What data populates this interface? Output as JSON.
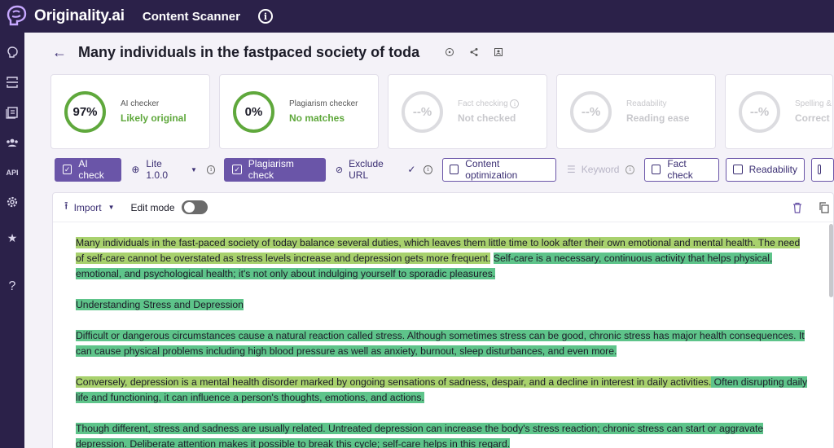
{
  "brand": {
    "name": "Originality.ai",
    "app_title": "Content Scanner"
  },
  "document": {
    "title": "Many individuals in the fastpaced society of toda"
  },
  "cards": [
    {
      "score": "97%",
      "label": "AI checker",
      "value": "Likely original",
      "active": true
    },
    {
      "score": "0%",
      "label": "Plagiarism checker",
      "value": "No matches",
      "active": true
    },
    {
      "score": "--%",
      "label": "Fact checking",
      "value": "Not checked",
      "active": false
    },
    {
      "score": "--%",
      "label": "Readability",
      "value": "Reading ease",
      "active": false
    },
    {
      "score": "--%",
      "label": "Spelling &",
      "value": "Correct",
      "active": false
    }
  ],
  "toolbar": {
    "ai_check": "AI check",
    "model": "Lite 1.0.0",
    "plagiarism_check": "Plagiarism check",
    "exclude_url": "Exclude URL",
    "content_optimization": "Content optimization",
    "keyword": "Keyword",
    "fact_check": "Fact check",
    "readability": "Readability"
  },
  "editor": {
    "import_label": "Import",
    "edit_mode_label": "Edit mode",
    "edit_mode_on": false,
    "paragraphs": [
      [
        {
          "text": "Many individuals in the fast-paced society of today balance several duties, which leaves them little time to look after their own emotional and mental health.  The need of self-care cannot be overstated as stress levels increase and depression gets more frequent.",
          "hl": "y"
        },
        {
          "text": "  ",
          "hl": ""
        },
        {
          "text": "Self-care is a necessary, continuous activity that helps physical, emotional, and psychological health; it's not only about indulging yourself to sporadic pleasures.",
          "hl": "g"
        }
      ],
      [
        {
          "text": "Understanding Stress and Depression",
          "hl": "g"
        }
      ],
      [
        {
          "text": "Difficult or dangerous circumstances cause a natural reaction called stress.  Although sometimes stress can be good, chronic stress has major health consequences.  It can cause physical problems including high blood pressure as well as anxiety, burnout, sleep disturbances, and even more.",
          "hl": "g"
        }
      ],
      [
        {
          "text": "Conversely, depression is a mental health disorder marked by ongoing sensations of sadness, despair, and a decline in interest in daily activities.",
          "hl": "y"
        },
        {
          "text": "  Often disrupting daily life and functioning, it can influence a person's thoughts, emotions, and actions.",
          "hl": "g"
        }
      ],
      [
        {
          "text": "Though different, stress and sadness are usually related.  Untreated depression can increase the body's stress reaction; chronic stress can start or aggravate depression.  Deliberate attention makes it possible to break this cycle; self-care helps in this regard.",
          "hl": "g"
        }
      ]
    ]
  },
  "colors": {
    "brand_dark": "#2b2149",
    "accent": "#6a55a8",
    "success": "#5fa83c",
    "highlight_yellow": "#a8d16d",
    "highlight_green": "#5ec48a"
  }
}
